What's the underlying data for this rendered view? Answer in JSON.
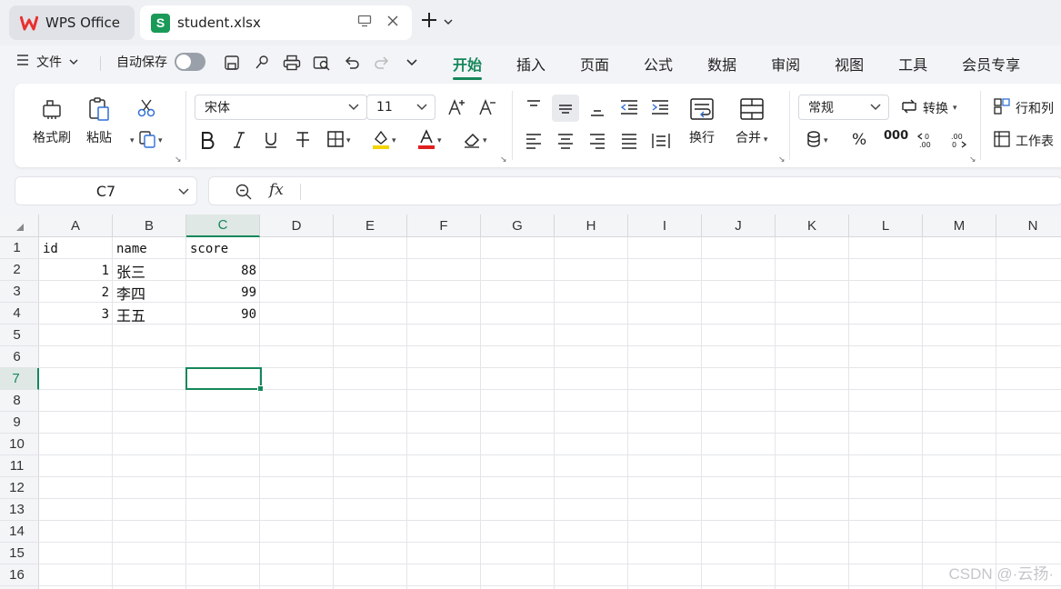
{
  "tabs": {
    "home_tab": "WPS Office",
    "file_tab": "student.xlsx"
  },
  "menu": {
    "file_label": "文件",
    "autosave_label": "自动保存"
  },
  "ribbon_tabs": [
    "开始",
    "插入",
    "页面",
    "公式",
    "数据",
    "审阅",
    "视图",
    "工具",
    "会员专享"
  ],
  "ribbon": {
    "format_painter": "格式刷",
    "paste": "粘贴",
    "font_name": "宋体",
    "font_size": "11",
    "wrap_text": "换行",
    "merge": "合并",
    "number_format": "常规",
    "convert": "转换",
    "rows_cols": "行和列",
    "worksheet": "工作表"
  },
  "formula_bar": {
    "cell_ref": "C7",
    "fx": "fx",
    "content": ""
  },
  "sheet": {
    "columns": [
      "A",
      "B",
      "C",
      "D",
      "E",
      "F",
      "G",
      "H",
      "I",
      "J",
      "K",
      "L",
      "M",
      "N"
    ],
    "rows": [
      "1",
      "2",
      "3",
      "4",
      "5",
      "6",
      "7",
      "8",
      "9",
      "10",
      "11",
      "12",
      "13",
      "14",
      "15",
      "16"
    ],
    "selected_cell": "C7",
    "headers": {
      "a": "id",
      "b": "name",
      "c": "score"
    },
    "data": [
      {
        "id": "1",
        "name": "张三",
        "score": "88"
      },
      {
        "id": "2",
        "name": "李四",
        "score": "99"
      },
      {
        "id": "3",
        "name": "王五",
        "score": "90"
      }
    ]
  },
  "watermark": "CSDN @·云扬·",
  "colors": {
    "accent": "#15875a",
    "sheet_icon": "#1a9a58",
    "wps_logo": "#e8312f"
  }
}
